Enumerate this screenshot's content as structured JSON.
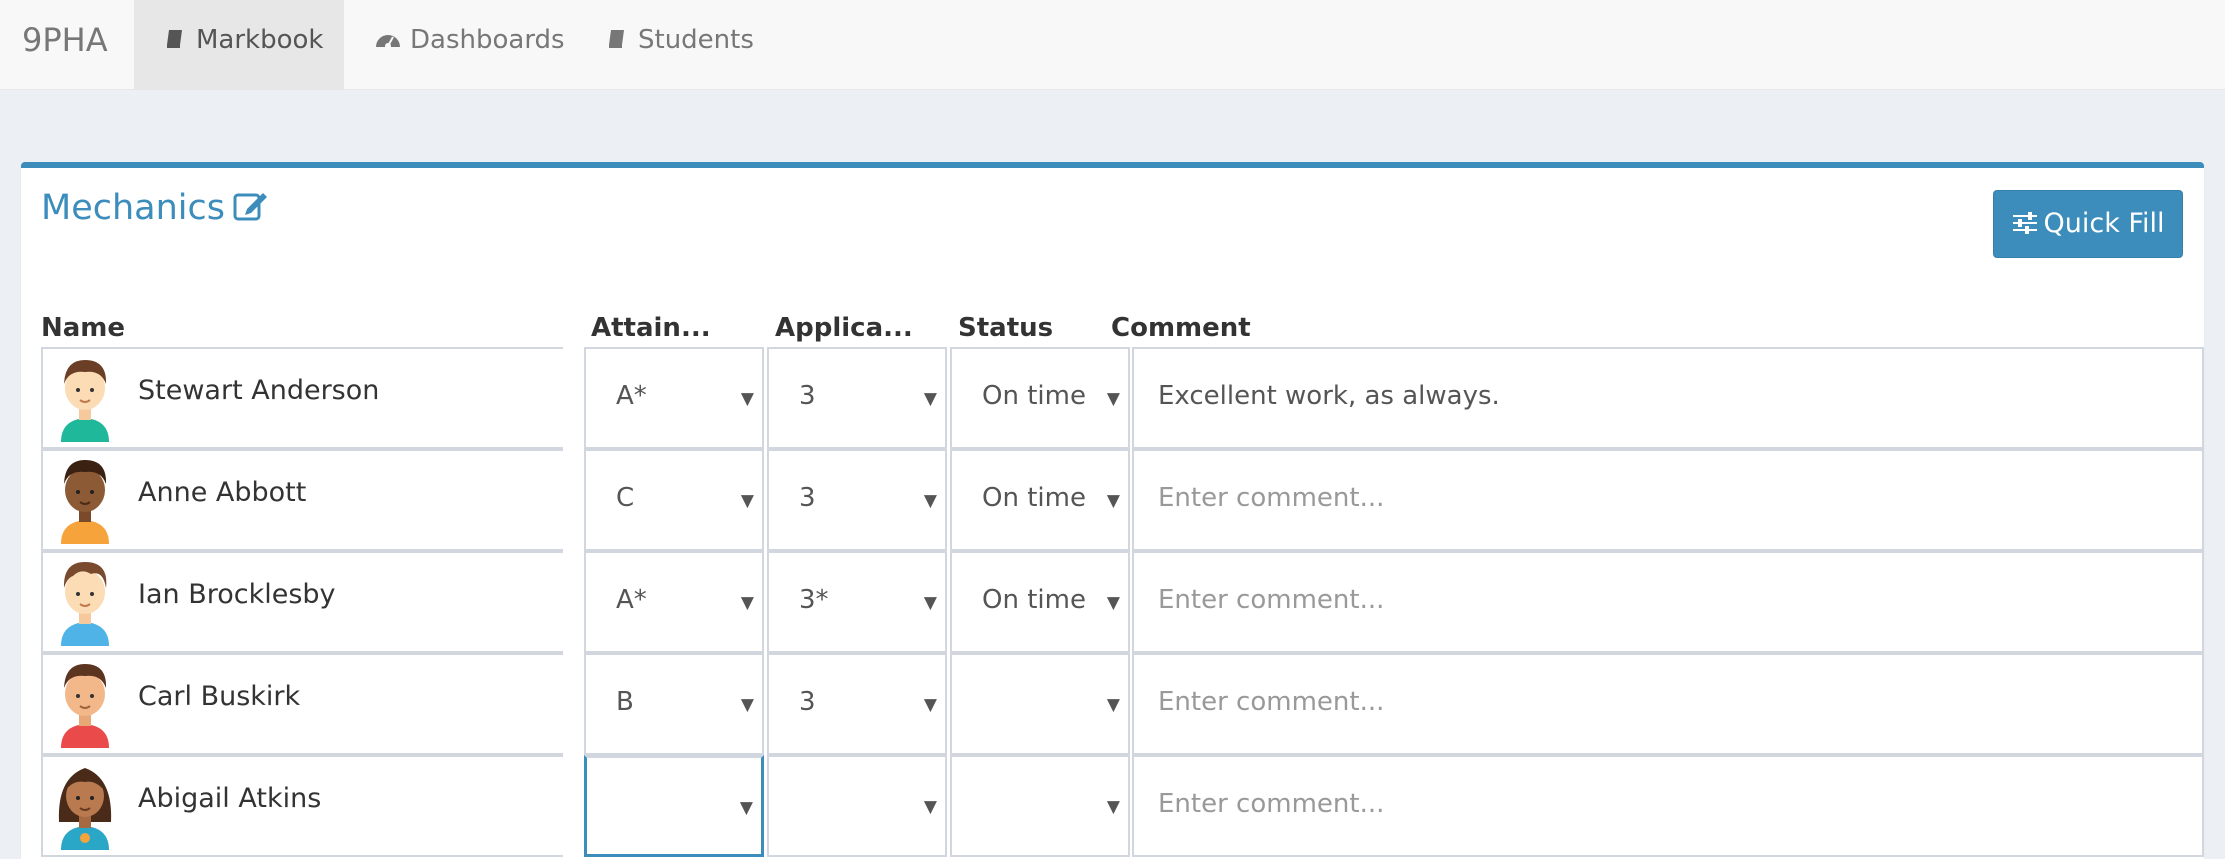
{
  "nav": {
    "brand": "9PHA",
    "items": [
      {
        "label": "Markbook",
        "active": true
      },
      {
        "label": "Dashboards",
        "active": false
      },
      {
        "label": "Students",
        "active": false
      }
    ]
  },
  "box": {
    "title": "Mechanics",
    "quick_fill": "Quick Fill"
  },
  "columns": [
    "Name",
    "Attain...",
    "Applica...",
    "Status",
    "Comment"
  ],
  "comment_placeholder": "Enter comment...",
  "students": [
    {
      "name": "Stewart Anderson",
      "attainment": "A*",
      "application": "3",
      "status": "On time",
      "comment": "Excellent work, as always.",
      "avatar": "boy-teal-shirt-avatar"
    },
    {
      "name": "Anne Abbott",
      "attainment": "C",
      "application": "3",
      "status": "On time",
      "comment": "",
      "avatar": "boy-orange-shirt-avatar"
    },
    {
      "name": "Ian Brocklesby",
      "attainment": "A*",
      "application": "3*",
      "status": "On time",
      "comment": "",
      "avatar": "boy-blue-shirt-avatar"
    },
    {
      "name": "Carl Buskirk",
      "attainment": "B",
      "application": "3",
      "status": "",
      "comment": "",
      "avatar": "boy-red-shirt-avatar"
    },
    {
      "name": "Abigail Atkins",
      "attainment": "",
      "application": "",
      "status": "",
      "comment": "",
      "avatar": "girl-blue-shirt-avatar"
    }
  ],
  "colors": {
    "accent": "#3c8dbc",
    "page_bg": "#ecf0f5",
    "nav_bg": "#f8f8f8"
  }
}
